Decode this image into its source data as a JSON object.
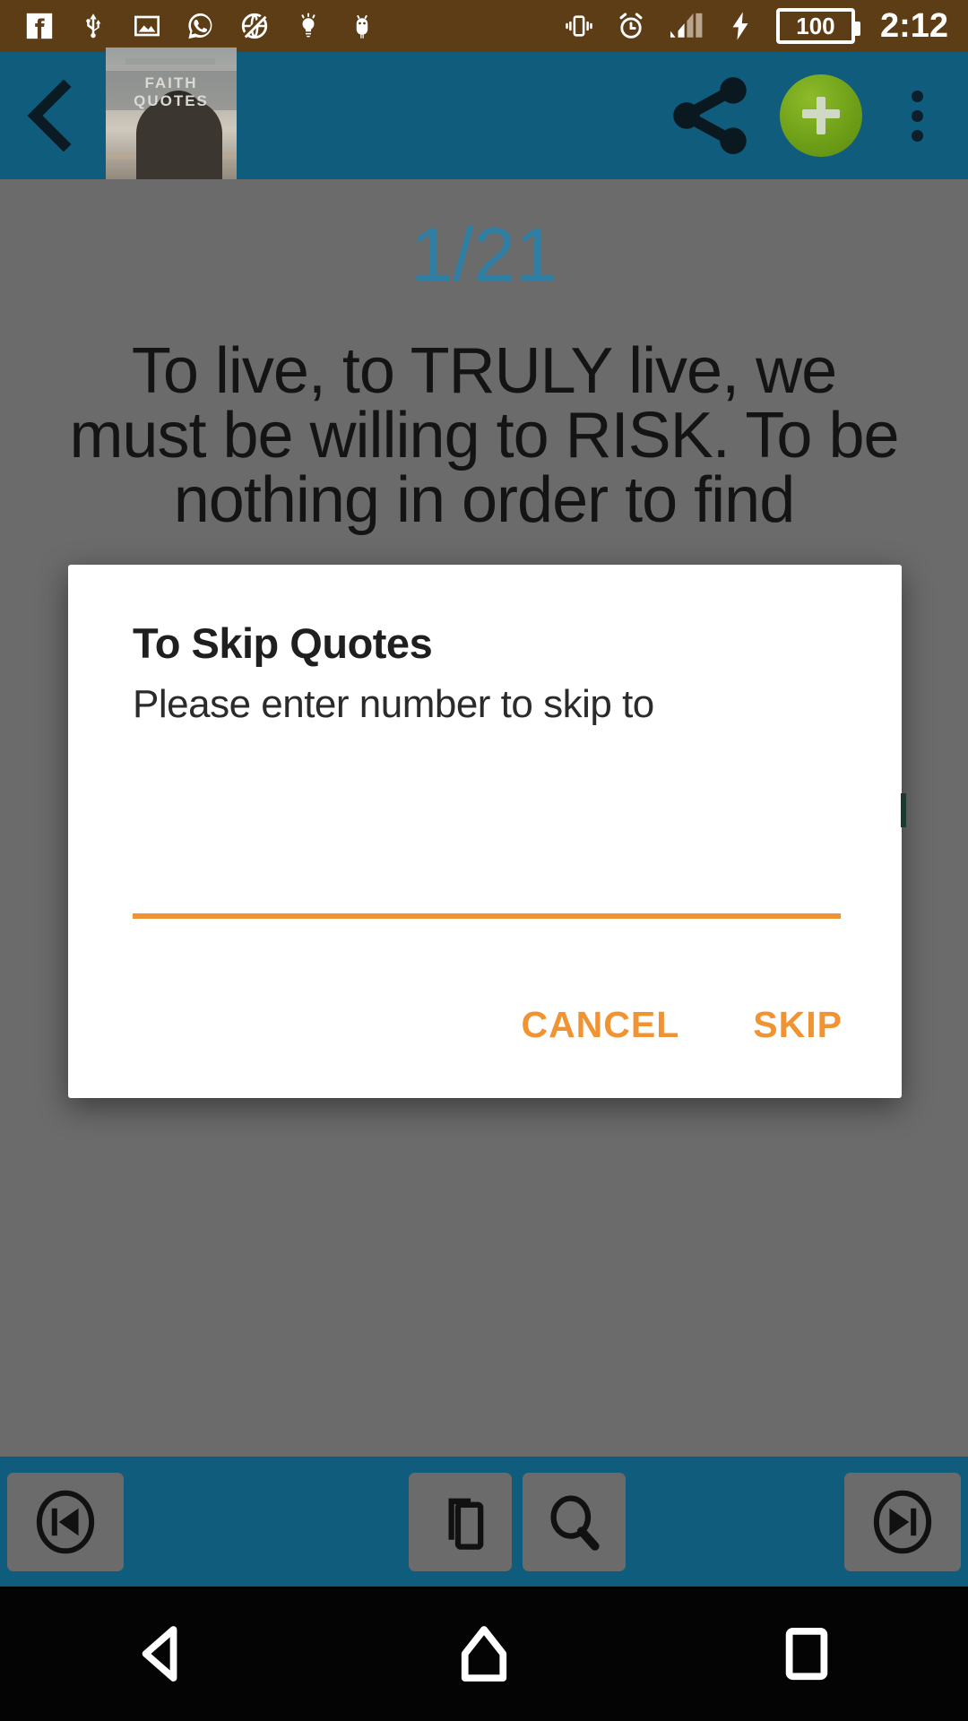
{
  "status_bar": {
    "time": "2:12",
    "battery_level": "100",
    "background_color": "#5c3d16",
    "left_icons": [
      {
        "name": "facebook-icon",
        "label": "Facebook"
      },
      {
        "name": "usb-icon",
        "label": "USB connected"
      },
      {
        "name": "image-icon",
        "label": "Screenshot captured"
      },
      {
        "name": "whatsapp-icon",
        "label": "WhatsApp"
      },
      {
        "name": "no-internet-icon",
        "label": "No internet"
      },
      {
        "name": "lightbulb-icon",
        "label": "Tip"
      },
      {
        "name": "android-bug-icon",
        "label": "Android"
      }
    ],
    "right_icons": [
      {
        "name": "vibrate-icon",
        "label": "Vibrate mode"
      },
      {
        "name": "alarm-icon",
        "label": "Alarm set"
      },
      {
        "name": "signal-bars-icon",
        "label": "Signal"
      },
      {
        "name": "charging-bolt-icon",
        "label": "Charging"
      }
    ]
  },
  "app_bar": {
    "background_color": "#0f5c7d",
    "back_label": "Back",
    "thumbnail_title": "FAITH QUOTES",
    "share_label": "Share",
    "add_label": "Add",
    "add_button_color": "#6fa018",
    "overflow_label": "More options"
  },
  "content": {
    "counter": "1/21",
    "counter_color": "#2e7fa3",
    "quote": "To live, to TRULY live, we must be willing to RISK. To be nothing in order to find"
  },
  "dialog": {
    "title": "To Skip Quotes",
    "message": "Please enter number to skip to",
    "input_value": "",
    "input_placeholder": "",
    "accent_color": "#f09433",
    "cancel_label": "CANCEL",
    "skip_label": "SKIP"
  },
  "bottom_bar": {
    "background_color": "#0f5c7d",
    "buttons": [
      {
        "name": "skip-previous-button",
        "label": "Previous"
      },
      {
        "name": "copy-button",
        "label": "Copy"
      },
      {
        "name": "search-button",
        "label": "Search"
      },
      {
        "name": "skip-next-button",
        "label": "Next"
      }
    ]
  },
  "nav_bar": {
    "back_label": "Back",
    "home_label": "Home",
    "recents_label": "Recent apps"
  }
}
